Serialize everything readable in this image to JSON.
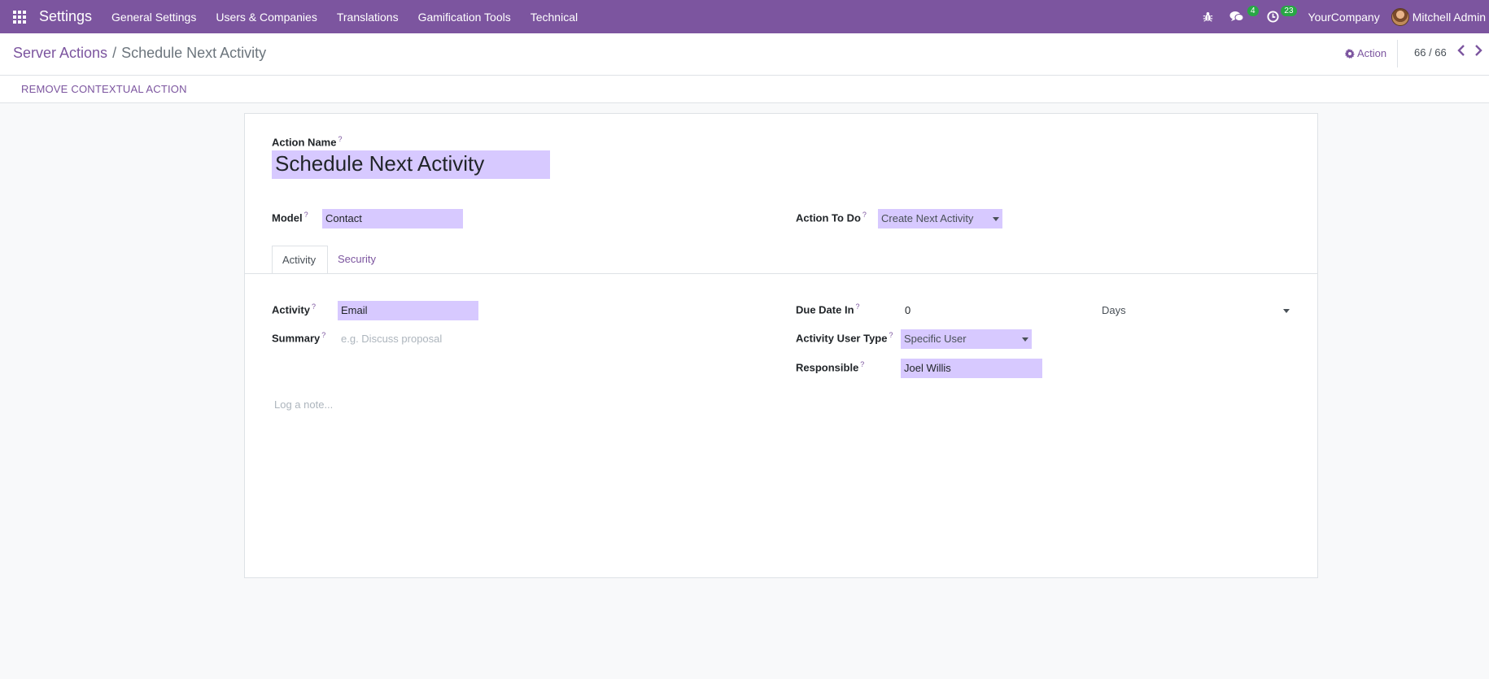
{
  "navbar": {
    "app_name": "Settings",
    "menu": [
      "General Settings",
      "Users & Companies",
      "Translations",
      "Gamification Tools",
      "Technical"
    ],
    "messages_count": "4",
    "activities_count": "23",
    "company": "YourCompany",
    "user": "Mitchell Admin"
  },
  "control": {
    "breadcrumb_parent": "Server Actions",
    "breadcrumb_separator": "/",
    "breadcrumb_current": "Schedule Next Activity",
    "action_label": "Action",
    "pager": "66 / 66"
  },
  "statusbar": {
    "remove_contextual_label": "REMOVE CONTEXTUAL ACTION"
  },
  "form": {
    "action_name_label": "Action Name",
    "action_name_value": "Schedule Next Activity",
    "model_label": "Model",
    "model_value": "Contact",
    "action_to_do_label": "Action To Do",
    "action_to_do_value": "Create Next Activity",
    "tabs": [
      "Activity",
      "Security"
    ],
    "activity_label": "Activity",
    "activity_value": "Email",
    "summary_label": "Summary",
    "summary_placeholder": "e.g. Discuss proposal",
    "due_date_label": "Due Date In",
    "due_date_value": "0",
    "due_date_unit": "Days",
    "user_type_label": "Activity User Type",
    "user_type_value": "Specific User",
    "responsible_label": "Responsible",
    "responsible_value": "Joel Willis",
    "note_placeholder": "Log a note...",
    "help_mark": "?"
  },
  "colors": {
    "brand": "#7c559f",
    "field_highlight": "#d7c9ff",
    "badge": "#28a745"
  },
  "icons": {
    "apps": "apps-grid-icon",
    "debug": "bug-icon",
    "messages": "chat-icon",
    "activities": "clock-icon",
    "action": "gear-icon",
    "prev": "chevron-left-icon",
    "next": "chevron-right-icon",
    "dropdown": "caret-down-icon"
  }
}
